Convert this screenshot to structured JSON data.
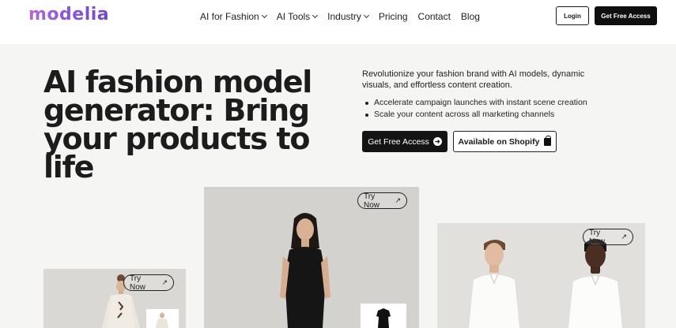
{
  "brand": {
    "logo_text": "modelia",
    "logo_color": "#8a55d6"
  },
  "nav": {
    "items": [
      {
        "label": "AI for Fashion",
        "dropdown": true
      },
      {
        "label": "AI Tools",
        "dropdown": true
      },
      {
        "label": "Industry",
        "dropdown": true
      },
      {
        "label": "Pricing",
        "dropdown": false
      },
      {
        "label": "Contact",
        "dropdown": false
      },
      {
        "label": "Blog",
        "dropdown": false
      }
    ],
    "login_label": "Login",
    "cta_label": "Get Free Access"
  },
  "hero": {
    "title_lines": [
      "AI fashion model",
      "generator: Bring",
      "your products to life"
    ],
    "description": "Revolutionize your fashion brand with AI models, dynamic visuals, and effortless content creation.",
    "bullets": [
      "Accelerate campaign launches with instant scene creation",
      "Scale your content across all marketing channels"
    ],
    "primary_button": "Get Free Access",
    "secondary_button": "Available on Shopify"
  },
  "cards": [
    {
      "try_label": "Try Now"
    },
    {
      "try_label": "Try Now"
    },
    {
      "try_label": "Try Now"
    }
  ],
  "icons": {
    "dropdown": "chevron-down-icon",
    "primary_arrow": "arrow-right-circle-icon",
    "shopify": "shopify-bag-icon",
    "try_arrow": "arrow-up-right-icon"
  },
  "colors": {
    "primary_button": "#141414",
    "background": "#f5f5f4"
  }
}
